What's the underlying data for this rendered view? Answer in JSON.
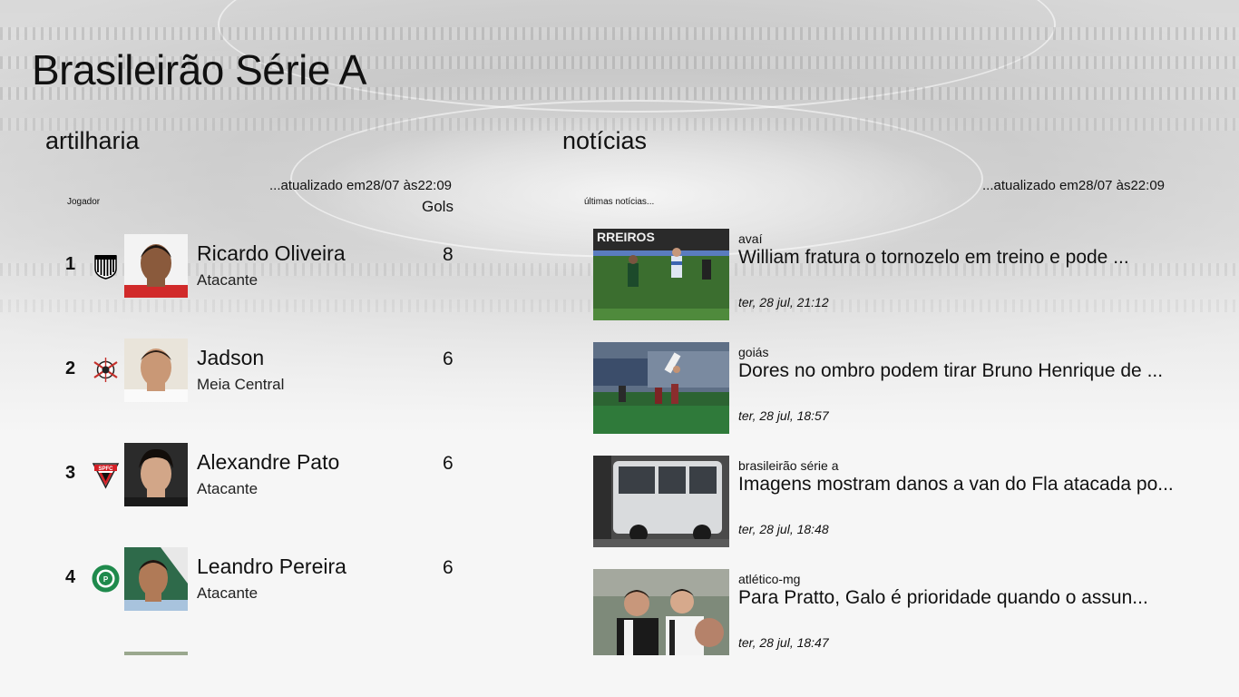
{
  "app": {
    "title": "Brasileirão Série A"
  },
  "scorers": {
    "header": "artilharia",
    "updated_prefix": "...atualizado em",
    "updated_date": "28/07",
    "updated_mid": " às",
    "updated_time": "22:09",
    "col_player": "Jogador",
    "col_goals": "Gols",
    "items": [
      {
        "rank": "1",
        "name": "Ricardo Oliveira",
        "position": "Atacante",
        "goals": "8",
        "club_icon": "santos-crest-icon"
      },
      {
        "rank": "2",
        "name": "Jadson",
        "position": "Meia Central",
        "goals": "6",
        "club_icon": "corinthians-crest-icon"
      },
      {
        "rank": "3",
        "name": "Alexandre Pato",
        "position": "Atacante",
        "goals": "6",
        "club_icon": "sao-paulo-crest-icon"
      },
      {
        "rank": "4",
        "name": "Leandro Pereira",
        "position": "Atacante",
        "goals": "6",
        "club_icon": "palmeiras-crest-icon"
      }
    ]
  },
  "news": {
    "header": "notícias",
    "updated_prefix": "...atualizado em",
    "updated_date": "28/07",
    "updated_mid": " às",
    "updated_time": "22:09",
    "subheader": "últimas notícias...",
    "items": [
      {
        "category": "avaí",
        "headline": "William fratura o tornozelo em treino e pode ...",
        "date": "ter, 28 jul, 21:12"
      },
      {
        "category": "goiás",
        "headline": "Dores no ombro podem tirar Bruno Henrique de ...",
        "date": "ter, 28 jul, 18:57"
      },
      {
        "category": "brasileirão série a",
        "headline": "Imagens mostram danos a van do Fla atacada po...",
        "date": "ter, 28 jul, 18:48"
      },
      {
        "category": "atlético-mg",
        "headline": "Para Pratto, Galo é prioridade quando o assun...",
        "date": "ter, 28 jul, 18:47"
      }
    ]
  },
  "colors": {
    "text": "#111111",
    "background": "#f4f4f4",
    "santos": "#000000",
    "corinthians_red": "#d0262b",
    "sao_paulo_red": "#d41f26",
    "palmeiras_green": "#1f8a4c"
  }
}
